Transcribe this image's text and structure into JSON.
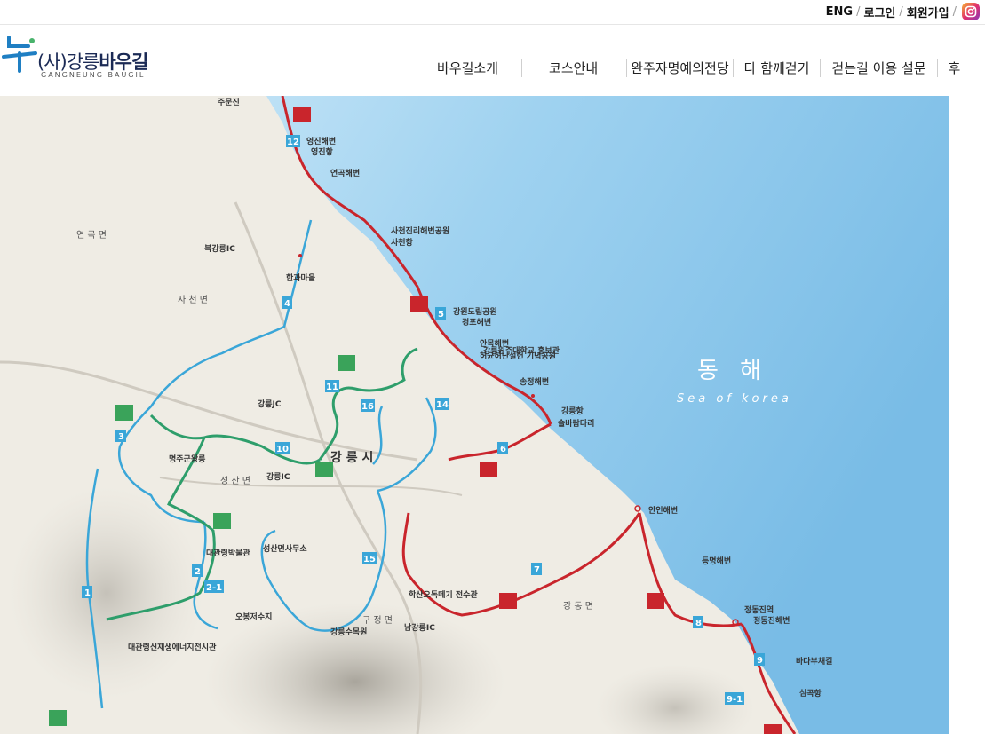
{
  "top_utility": {
    "eng": "ENG",
    "separator": "/",
    "login": "로그인",
    "signup": "회원가입"
  },
  "logo": {
    "main_prefix": "(사)강릉",
    "main_bold": "바우길",
    "sub": "GANGNEUNG BAUGIL"
  },
  "nav": {
    "items": [
      "바우길소개",
      "코스안내",
      "완주자명예의전당",
      "다 함께걷기",
      "걷는길 이용 설문",
      "후"
    ]
  },
  "map": {
    "sea_name_ko": "동 해",
    "sea_name_en": "Sea of korea",
    "city_label": "강 릉 시",
    "district_labels": [
      "연 곡 면",
      "사 천 면",
      "성 산 면",
      "구 정 면",
      "강 동 면"
    ],
    "place_labels": [
      "주문진",
      "영진해변",
      "영진항",
      "연곡해변",
      "사천진리해변공원",
      "사천항",
      "한과마을",
      "강원도립공원",
      "경포해변",
      "허균허난설헌 기념공원",
      "강릉원주대학교 홍보관",
      "송정해변",
      "안목해변",
      "솔바람다리",
      "강릉항",
      "안인해변",
      "정동진역",
      "정동진해변",
      "바다부채길",
      "등명해변",
      "명주군왕릉",
      "성산면사무소",
      "대관령박물관",
      "대관령신재생에너지전시관",
      "강릉수목원",
      "학산오독떼기 전수관",
      "강릉IC",
      "북강릉IC",
      "강릉JC",
      "남강릉IC",
      "오봉저수지",
      "심곡항"
    ],
    "course_numbers": [
      "1",
      "2",
      "2-1",
      "3",
      "4",
      "5",
      "6",
      "7",
      "8",
      "9",
      "9-1",
      "10",
      "11",
      "12",
      "14",
      "15",
      "16"
    ]
  },
  "colors": {
    "accent_red": "#c9252c",
    "trail_blue": "#3aa6d8",
    "trail_green": "#2e9e6b",
    "sea": "#8dcbee",
    "land": "#efece4"
  }
}
